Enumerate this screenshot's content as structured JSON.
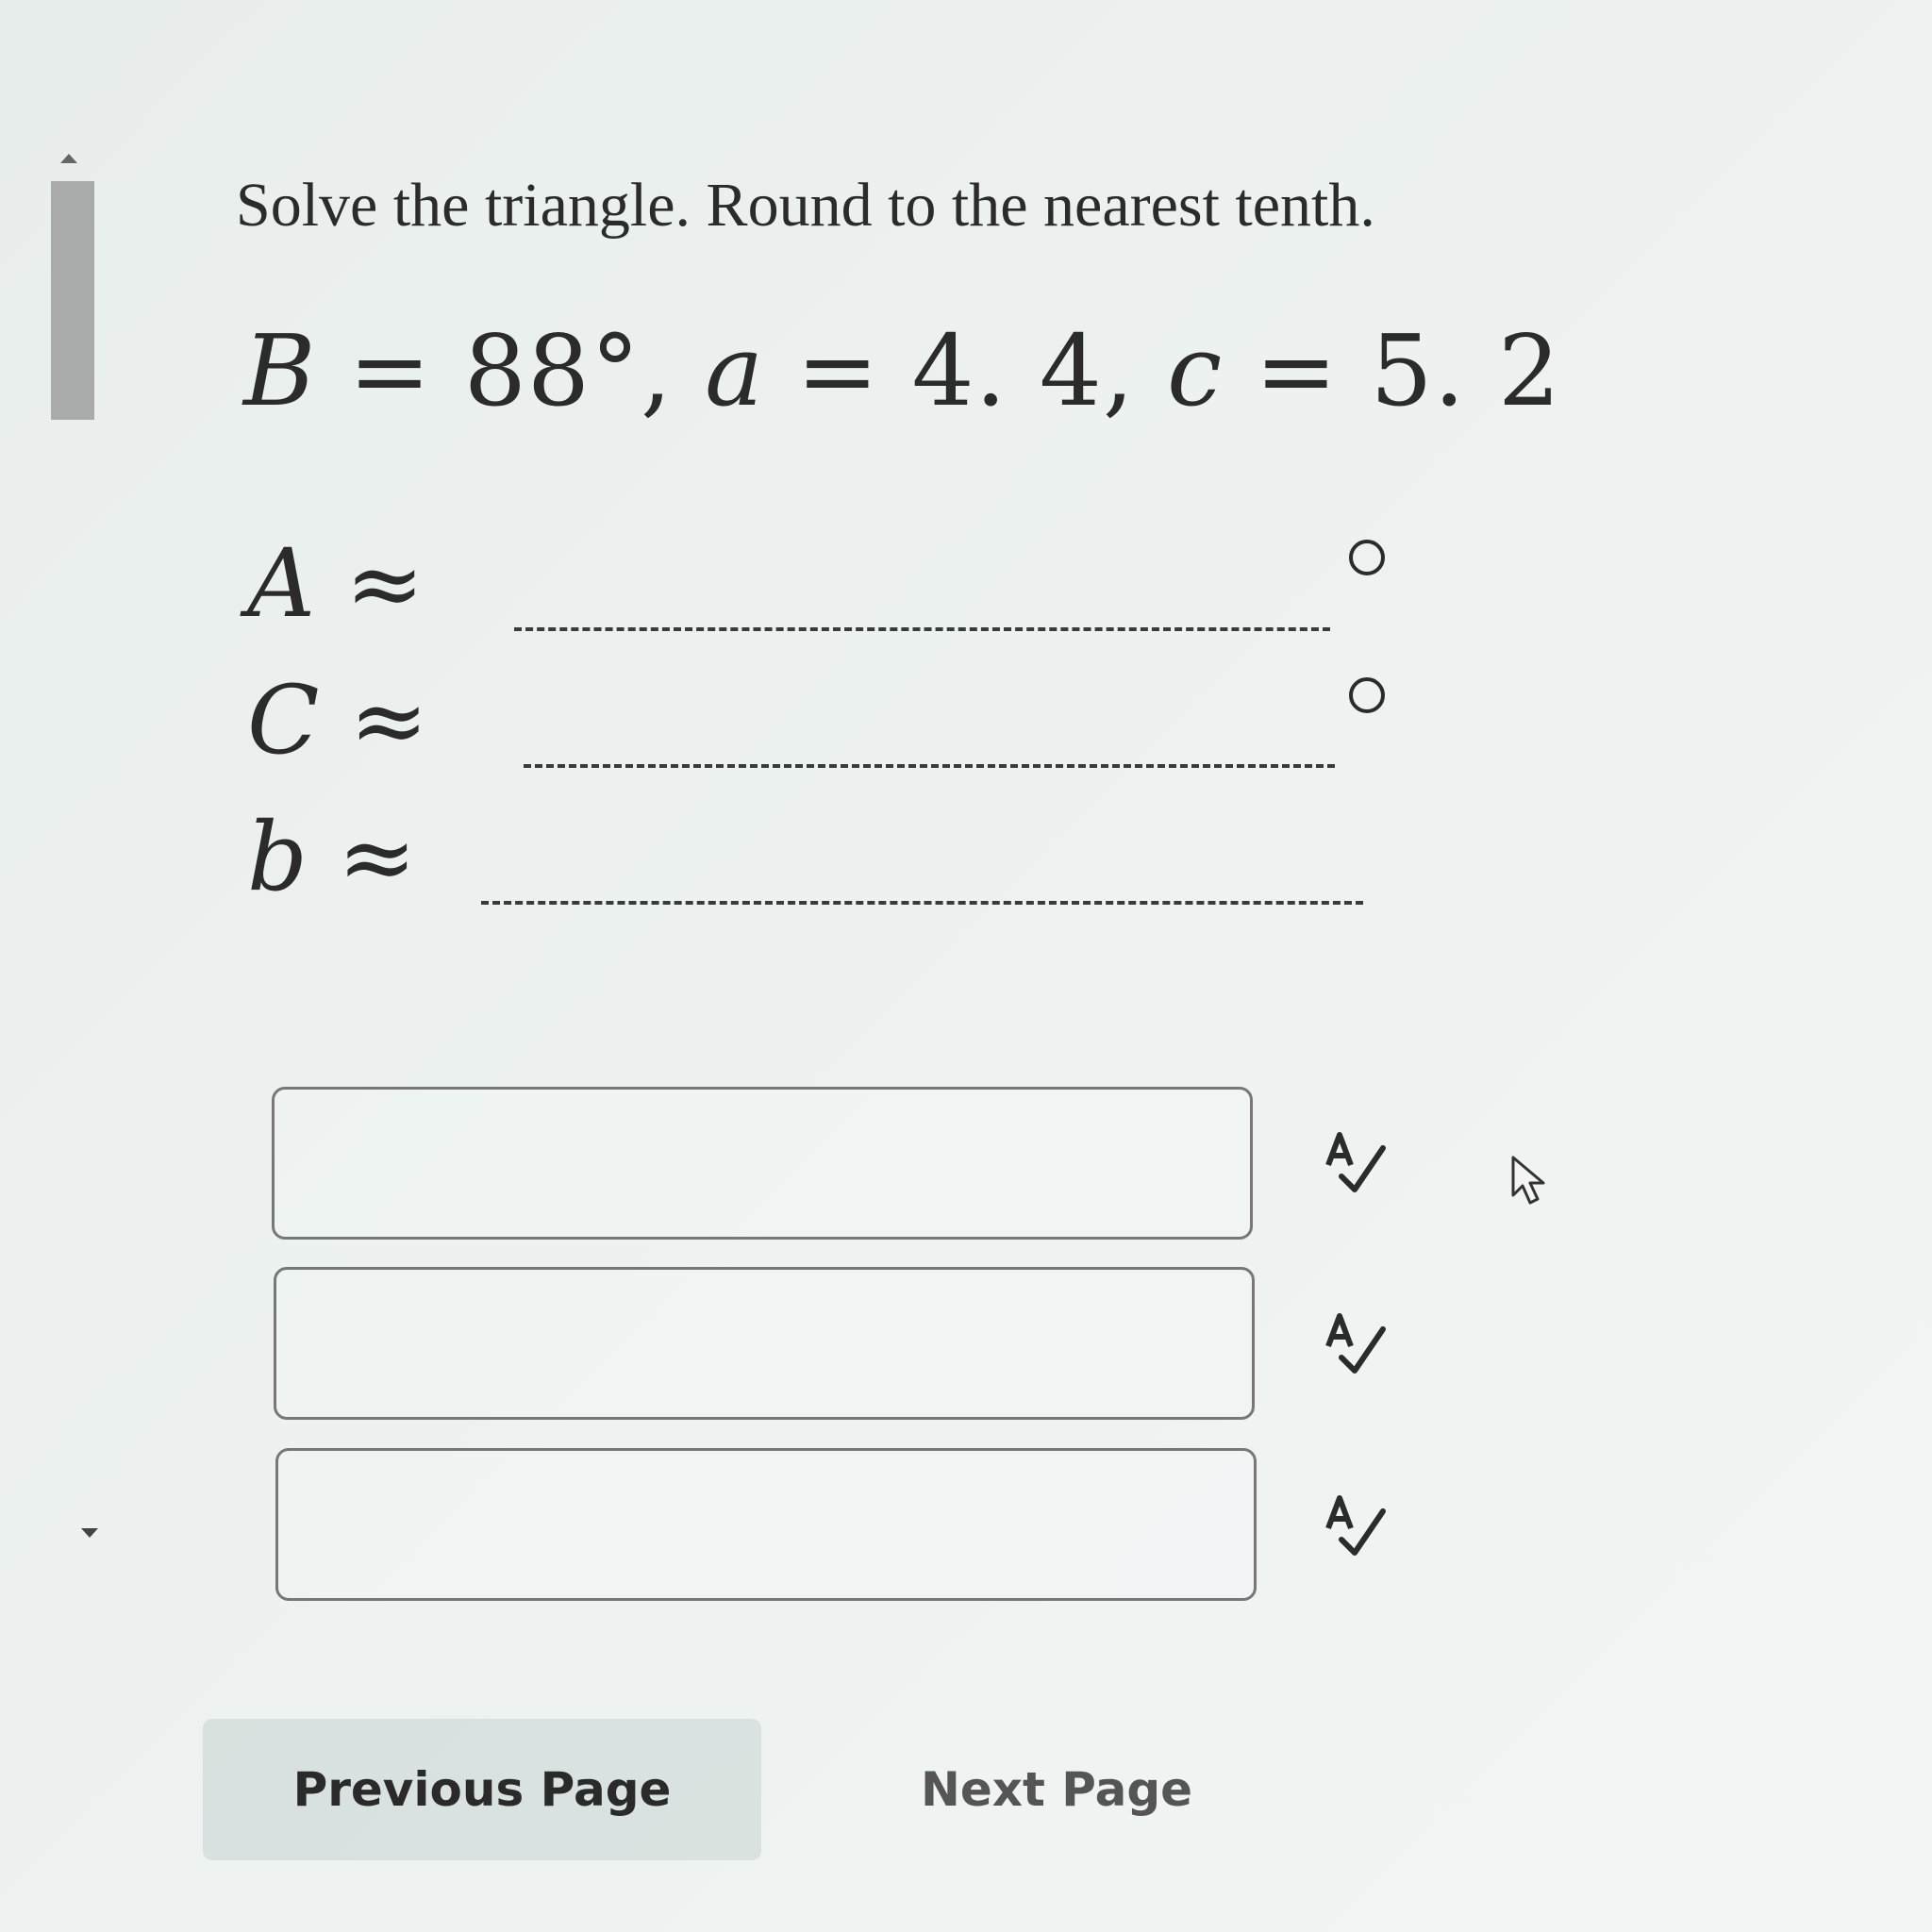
{
  "question": {
    "instruction": "Solve the triangle. Round to the nearest tenth.",
    "given": {
      "B_label": "B",
      "B_value": "88°",
      "a_label": "a",
      "a_value": "4. 4",
      "c_label": "c",
      "c_value": "5. 2"
    }
  },
  "answers": [
    {
      "label": "A",
      "symbol": "≈",
      "unit": "degree",
      "value": ""
    },
    {
      "label": "C",
      "symbol": "≈",
      "unit": "degree",
      "value": ""
    },
    {
      "label": "b",
      "symbol": "≈",
      "unit": "",
      "value": ""
    }
  ],
  "icons": {
    "spellcheck": "spellcheck-icon",
    "cursor": "mouse-pointer-icon"
  },
  "navigation": {
    "previous_label": "Previous Page",
    "next_label": "Next Page"
  }
}
